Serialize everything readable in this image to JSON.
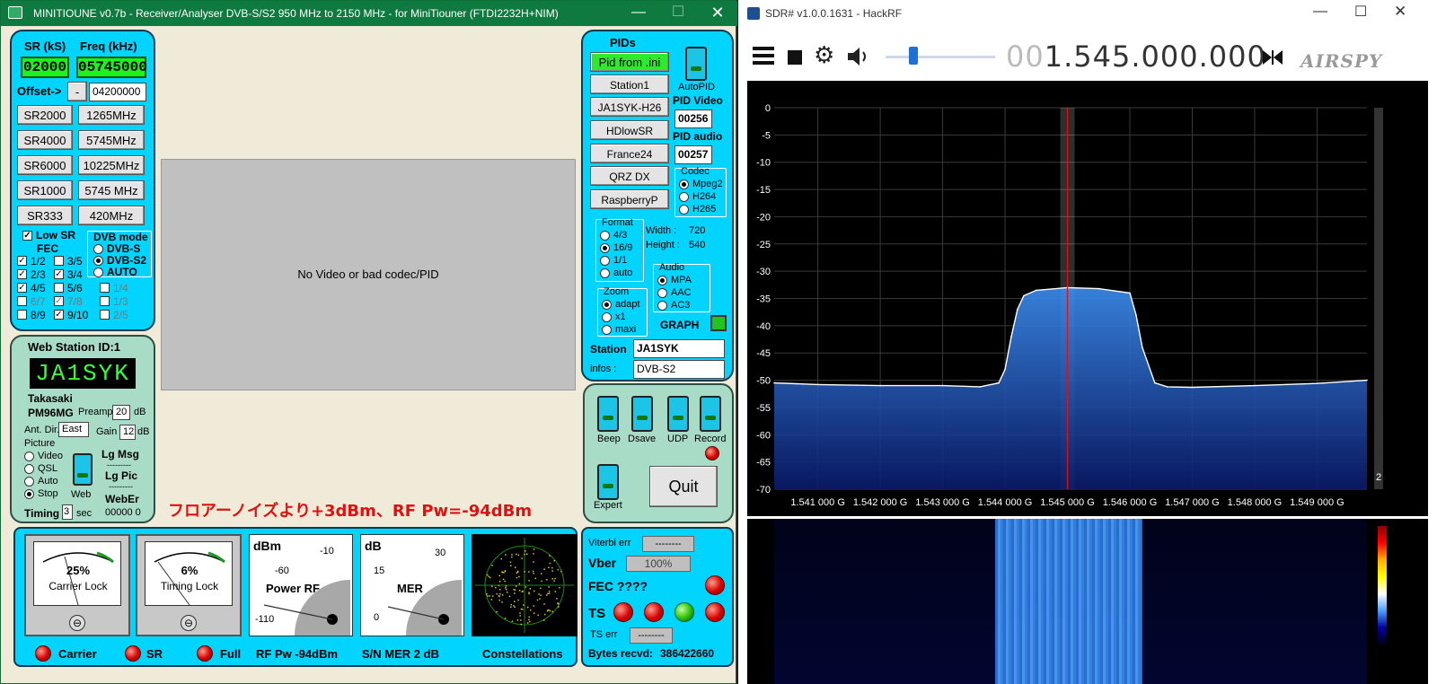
{
  "minitiouner": {
    "title": "MINITIOUNE v0.7b - Receiver/Analyser DVB-S/S2 950 MHz to 2150 MHz - for MiniTiouner (FTDI2232H+NIM)",
    "tuning": {
      "sr_label": "SR (kS)",
      "freq_label": "Freq (kHz)",
      "sr_value": "02000",
      "freq_value": "05745000",
      "offset_label": "Offset->",
      "offset_sign": "-",
      "offset_value": "04200000",
      "sr_buttons": [
        "SR2000",
        "SR4000",
        "SR6000",
        "SR1000",
        "SR333"
      ],
      "freq_buttons": [
        "1265MHz",
        "5745MHz",
        "10225MHz",
        "5745 MHz",
        "420MHz"
      ],
      "low_sr": "Low SR",
      "fec_label": "FEC",
      "fec": [
        {
          "label": "1/2",
          "checked": "✓"
        },
        {
          "label": "3/5",
          "checked": ""
        },
        {
          "label": "2/3",
          "checked": "✓"
        },
        {
          "label": "3/4",
          "checked": "✓"
        },
        {
          "label": "4/5",
          "checked": "✓"
        },
        {
          "label": "5/6",
          "checked": ""
        },
        {
          "label": "6/7",
          "checked": ""
        },
        {
          "label": "7/8",
          "checked": "✓"
        },
        {
          "label": "8/9",
          "checked": ""
        },
        {
          "label": "9/10",
          "checked": "✓"
        }
      ],
      "fec_extra": [
        "1/4",
        "1/3",
        "2/5"
      ],
      "dvb_mode_label": "DVB mode",
      "dvb_modes": [
        "DVB-S",
        "DVB-S2",
        "AUTO"
      ]
    },
    "video_placeholder": "No Video or bad codec/PID",
    "pids": {
      "title": "PIDs",
      "pid_from_ini": "Pid from .ini",
      "stations": [
        "Station1",
        "JA1SYK-H26",
        "HDlowSR",
        "France24",
        "QRZ DX",
        "RaspberryP"
      ],
      "autopid": "AutoPID",
      "pid_video_label": "PID Video",
      "pid_video": "00256",
      "pid_audio_label": "PID audio",
      "pid_audio": "00257",
      "codec_label": "Codec",
      "codecs": [
        "Mpeg2",
        "H264",
        "H265"
      ],
      "format_label": "Format",
      "formats": [
        "4/3",
        "16/9",
        "1/1",
        "auto"
      ],
      "width_label": "Width :",
      "width": "720",
      "height_label": "Height :",
      "height": "540",
      "audio_label": "Audio",
      "audios": [
        "MPA",
        "AAC",
        "AC3"
      ],
      "zoom_label": "Zoom",
      "zooms": [
        "adapt",
        "x1",
        "maxi"
      ],
      "graph_label": "GRAPH",
      "station_label": "Station",
      "station": "JA1SYK",
      "infos_label": "infos :",
      "infos": "DVB-S2"
    },
    "controls": {
      "beep": "Beep",
      "dsave": "Dsave",
      "udp": "UDP",
      "record": "Record",
      "expert": "Expert",
      "quit": "Quit"
    },
    "web": {
      "title": "Web Station ID:1",
      "callsign": "JA1SYK",
      "city": "Takasaki",
      "locator": "PM96MG",
      "preamp_label": "Preamp",
      "preamp": "20",
      "db": "dB",
      "ant_label": "Ant. Dir.",
      "ant_dir": "East",
      "gain_label": "Gain",
      "gain": "12",
      "picture_label": "Picture",
      "pictures": [
        "Video",
        "QSL",
        "Auto",
        "Stop"
      ],
      "web_label": "Web",
      "lg_msg": "Lg Msg",
      "dashes": "---------",
      "lg_pic": "Lg Pic",
      "weber": "WebEr",
      "weber_value": "00000  0",
      "timing_label": "Timing",
      "timing": "3",
      "sec": "sec"
    },
    "note": "フロアーノイズより+3dBm、RF  Pw=-94dBm",
    "meters": {
      "carrier_pct": "25%",
      "carrier_lock": "Carrier Lock",
      "timing_pct": "6%",
      "timing_lock": "Timing Lock",
      "power_unit": "dBm",
      "power_ticks": [
        "-60",
        "-10",
        "-110"
      ],
      "power_label": "Power RF",
      "mer_unit": "dB",
      "mer_ticks": [
        "15",
        "30",
        "0"
      ],
      "mer_label": "MER",
      "carrier": "Carrier",
      "sr": "SR",
      "full": "Full",
      "rf_pw": "RF Pw -94dBm",
      "sn_mer": "S/N MER  2 dB",
      "constellations": "Constellations"
    },
    "status": {
      "viterbi_label": "Viterbi err",
      "viterbi": "--------",
      "vber_label": "Vber",
      "vber": "100%",
      "fec_label": "FEC ????",
      "ts_label": "TS",
      "ts_err_label": "TS err",
      "ts_err": "--------",
      "bytes_label": "Bytes recvd:",
      "bytes": "386422660"
    }
  },
  "sdr": {
    "title": "SDR# v1.0.0.1631 - HackRF",
    "freq_dim": "00",
    "freq_main": "1.545.000.000",
    "brand": "AIRSPY",
    "scale_value": "2",
    "chart_data": {
      "type": "line",
      "title": "",
      "xlabel": "",
      "ylabel": "",
      "x_unit": "GHz",
      "x_ticks": [
        "1.541 000 G",
        "1.542 000 G",
        "1.543 000 G",
        "1.544 000 G",
        "1.545 000 G",
        "1.546 000 G",
        "1.547 000 G",
        "1.548 000 G",
        "1.549 000 G"
      ],
      "y_ticks": [
        "0",
        "-5",
        "-10",
        "-15",
        "-20",
        "-25",
        "-30",
        "-35",
        "-40",
        "-45",
        "-50",
        "-55",
        "-60",
        "-65",
        "-70"
      ],
      "xlim": [
        1.5403,
        1.5498
      ],
      "ylim": [
        -70,
        0
      ],
      "grid": true,
      "center_freq": 1.545,
      "series": [
        {
          "x": [
            1.5403,
            1.541,
            1.542,
            1.543,
            1.5436,
            1.5439,
            1.544,
            1.5441,
            1.5442,
            1.5443,
            1.5445,
            1.545,
            1.5455,
            1.546,
            1.5461,
            1.5462,
            1.5464,
            1.5466,
            1.547,
            1.548,
            1.549,
            1.5498
          ],
          "values": [
            -50.5,
            -50.8,
            -51,
            -51,
            -51.2,
            -50.5,
            -48,
            -42,
            -37,
            -34.5,
            -33.5,
            -33,
            -33.2,
            -34,
            -38,
            -44,
            -50.5,
            -51.2,
            -51.3,
            -51,
            -50.6,
            -50
          ]
        }
      ]
    }
  }
}
